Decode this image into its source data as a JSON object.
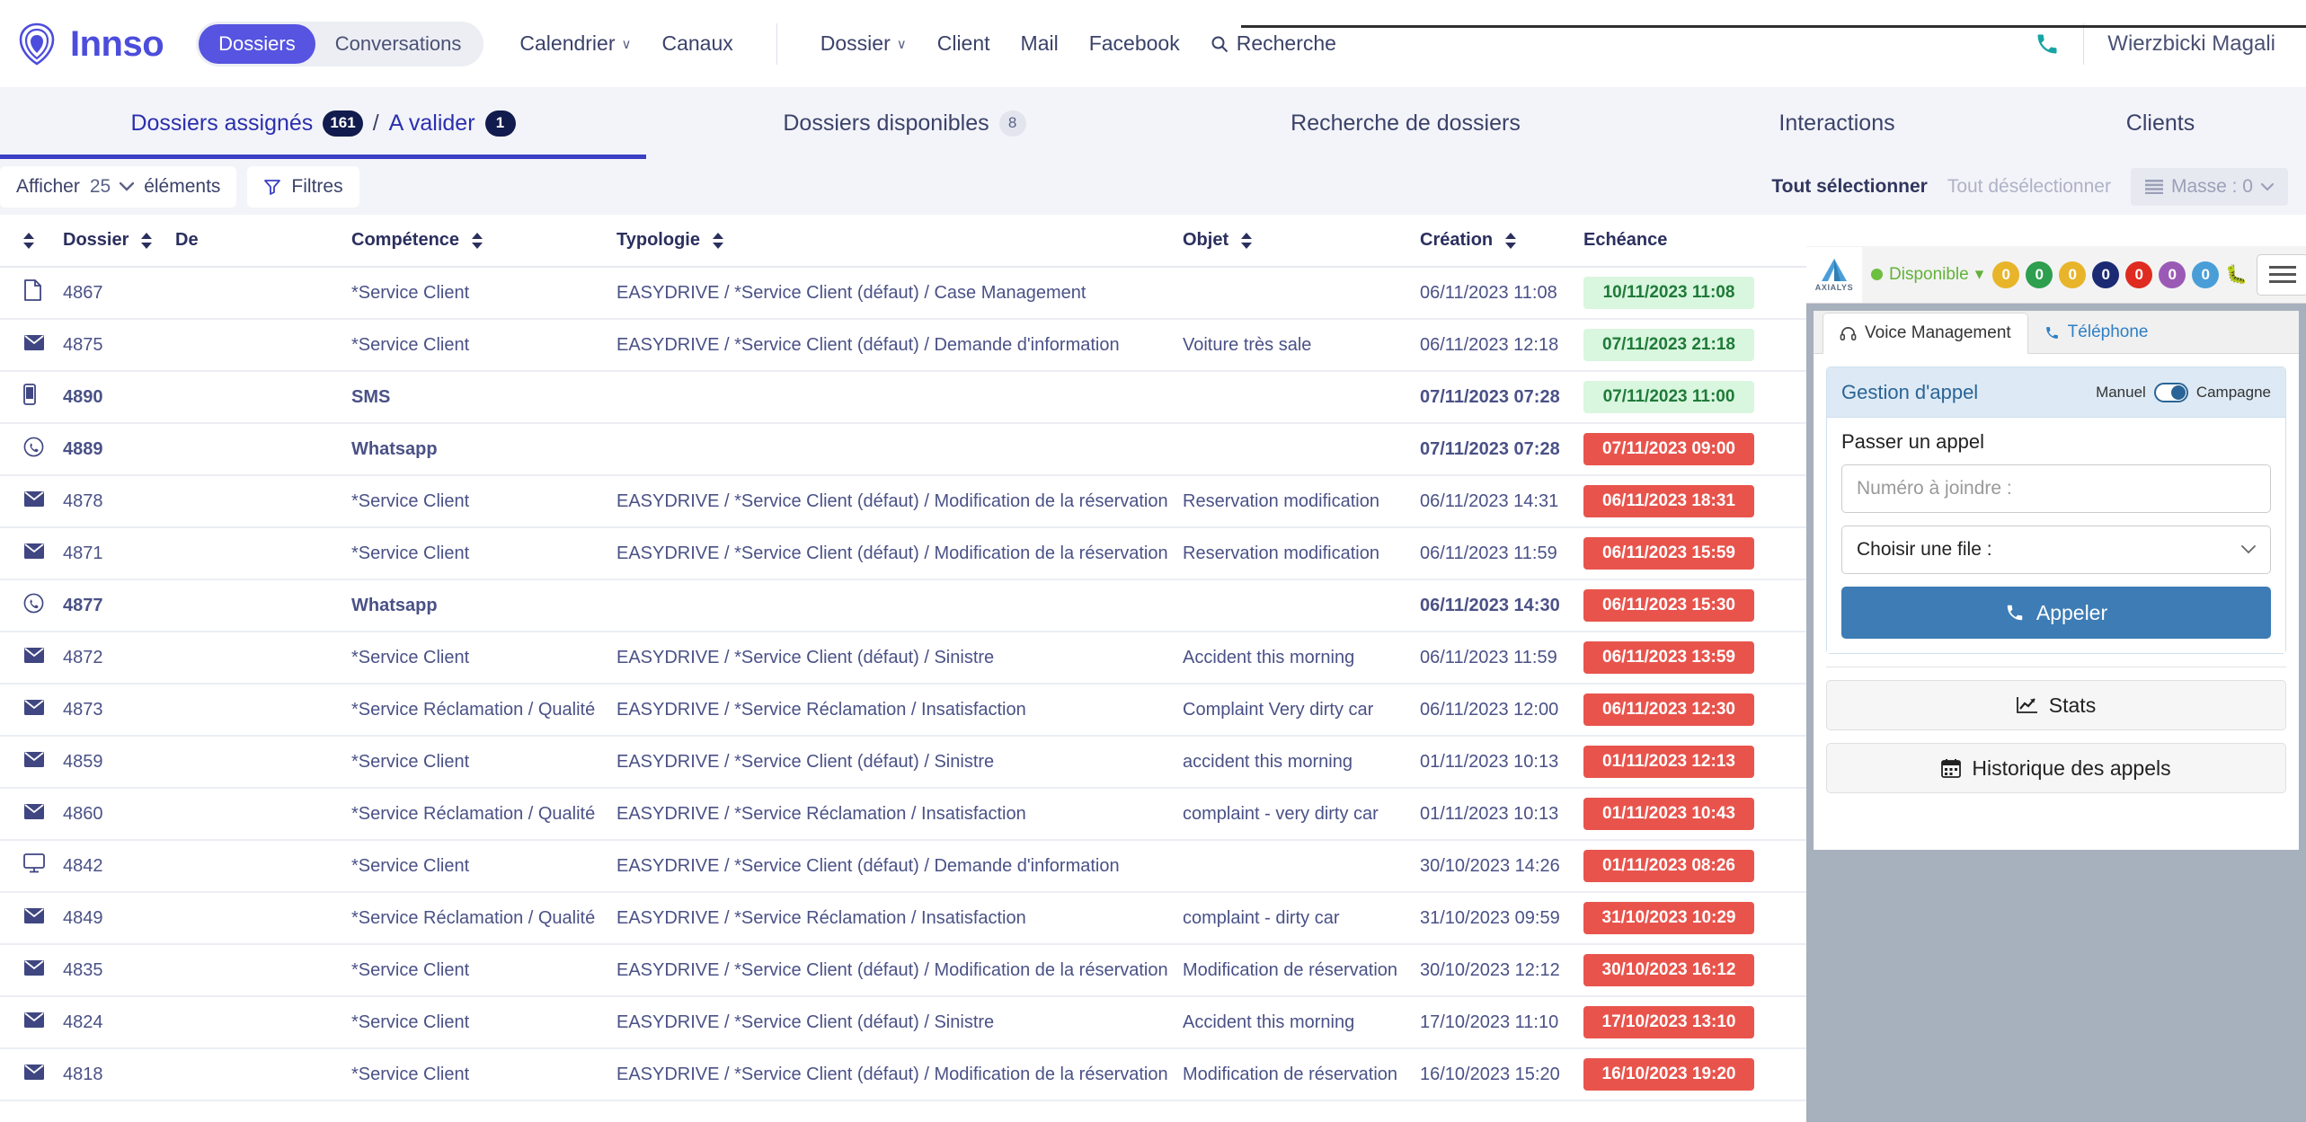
{
  "brand": {
    "name": "Innso",
    "logo_icon": "innso-logo-icon"
  },
  "topnav": {
    "segments": [
      {
        "label": "Dossiers",
        "active": true
      },
      {
        "label": "Conversations",
        "active": false
      }
    ],
    "items": [
      {
        "label": "Calendrier",
        "caret": "∨"
      },
      {
        "label": "Canaux",
        "caret": ""
      }
    ],
    "items2": [
      {
        "label": "Dossier",
        "caret": "∨"
      },
      {
        "label": "Client",
        "caret": ""
      },
      {
        "label": "Mail",
        "caret": ""
      },
      {
        "label": "Facebook",
        "caret": ""
      }
    ],
    "search_label": "Recherche",
    "search_icon": "search-icon",
    "phone_icon": "phone-icon",
    "username": "Wierzbicki Magali"
  },
  "maintabs": [
    {
      "label": "Dossiers assignés",
      "badge": "161",
      "label2": "A valider",
      "badge2": "1",
      "separator": "/",
      "active": true
    },
    {
      "label": "Dossiers disponibles",
      "badge": "8",
      "active": false
    },
    {
      "label": "Recherche de dossiers",
      "active": false
    },
    {
      "label": "Interactions",
      "active": false
    },
    {
      "label": "Clients",
      "active": false
    }
  ],
  "toolbar": {
    "show_label": "Afficher",
    "show_value": "25",
    "elements_label": "éléments",
    "filters_label": "Filtres",
    "filter_icon": "filter-icon",
    "select_all": "Tout sélectionner",
    "deselect_all": "Tout désélectionner",
    "mass_label": "Masse : 0",
    "mass_icon": "list-icon"
  },
  "table": {
    "columns": [
      {
        "key": "icon",
        "label": "",
        "sortable": true
      },
      {
        "key": "dossier",
        "label": "Dossier",
        "sortable": true
      },
      {
        "key": "de",
        "label": "De",
        "sortable": true
      },
      {
        "key": "competence",
        "label": "Compétence",
        "sortable": true
      },
      {
        "key": "typologie",
        "label": "Typologie",
        "sortable": true
      },
      {
        "key": "objet",
        "label": "Objet",
        "sortable": true
      },
      {
        "key": "creation",
        "label": "Création",
        "sortable": true
      },
      {
        "key": "echeance",
        "label": "Echéance",
        "sortable": false
      }
    ],
    "rows": [
      {
        "icon": "document-icon",
        "glyph": "🗋",
        "dossier": "4867",
        "de": "",
        "competence": "*Service Client",
        "typologie": "EASYDRIVE / *Service Client (défaut) / Case Management",
        "objet": "",
        "creation": "06/11/2023 11:08",
        "echeance": "10/11/2023 11:08",
        "echeance_state": "green",
        "bold": false
      },
      {
        "icon": "mail-icon",
        "glyph": "✉",
        "dossier": "4875",
        "de": "",
        "competence": "*Service Client",
        "typologie": "EASYDRIVE / *Service Client (défaut) / Demande d'information",
        "objet": "Voiture très sale",
        "creation": "06/11/2023 12:18",
        "echeance": "07/11/2023 21:18",
        "echeance_state": "green",
        "bold": false
      },
      {
        "icon": "sms-icon",
        "glyph": "📱",
        "dossier": "4890",
        "de": "",
        "competence": "SMS",
        "typologie": "",
        "objet": "",
        "creation": "07/11/2023 07:28",
        "echeance": "07/11/2023 11:00",
        "echeance_state": "green",
        "bold": true
      },
      {
        "icon": "whatsapp-icon",
        "glyph": "ⓦ",
        "dossier": "4889",
        "de": "",
        "competence": "Whatsapp",
        "typologie": "",
        "objet": "",
        "creation": "07/11/2023 07:28",
        "echeance": "07/11/2023 09:00",
        "echeance_state": "red",
        "bold": true
      },
      {
        "icon": "mail-icon",
        "glyph": "✉",
        "dossier": "4878",
        "de": "",
        "competence": "*Service Client",
        "typologie": "EASYDRIVE / *Service Client (défaut) / Modification de la réservation",
        "objet": "Reservation modification",
        "creation": "06/11/2023 14:31",
        "echeance": "06/11/2023 18:31",
        "echeance_state": "red",
        "bold": false
      },
      {
        "icon": "mail-icon",
        "glyph": "✉",
        "dossier": "4871",
        "de": "",
        "competence": "*Service Client",
        "typologie": "EASYDRIVE / *Service Client (défaut) / Modification de la réservation",
        "objet": "Reservation modification",
        "creation": "06/11/2023 11:59",
        "echeance": "06/11/2023 15:59",
        "echeance_state": "red",
        "bold": false
      },
      {
        "icon": "whatsapp-icon",
        "glyph": "ⓦ",
        "dossier": "4877",
        "de": "",
        "competence": "Whatsapp",
        "typologie": "",
        "objet": "",
        "creation": "06/11/2023 14:30",
        "echeance": "06/11/2023 15:30",
        "echeance_state": "red",
        "bold": true
      },
      {
        "icon": "mail-icon",
        "glyph": "✉",
        "dossier": "4872",
        "de": "",
        "competence": "*Service Client",
        "typologie": "EASYDRIVE / *Service Client (défaut) / Sinistre",
        "objet": "Accident this morning",
        "creation": "06/11/2023 11:59",
        "echeance": "06/11/2023 13:59",
        "echeance_state": "red",
        "bold": false
      },
      {
        "icon": "mail-icon",
        "glyph": "✉",
        "dossier": "4873",
        "de": "",
        "competence": "*Service Réclamation / Qualité",
        "typologie": "EASYDRIVE / *Service Réclamation / Insatisfaction",
        "objet": "Complaint Very dirty car",
        "creation": "06/11/2023 12:00",
        "echeance": "06/11/2023 12:30",
        "echeance_state": "red",
        "bold": false
      },
      {
        "icon": "mail-icon",
        "glyph": "✉",
        "dossier": "4859",
        "de": "",
        "competence": "*Service Client",
        "typologie": "EASYDRIVE / *Service Client (défaut) / Sinistre",
        "objet": "accident this morning",
        "creation": "01/11/2023 10:13",
        "echeance": "01/11/2023 12:13",
        "echeance_state": "red",
        "bold": false
      },
      {
        "icon": "mail-icon",
        "glyph": "✉",
        "dossier": "4860",
        "de": "",
        "competence": "*Service Réclamation / Qualité",
        "typologie": "EASYDRIVE / *Service Réclamation / Insatisfaction",
        "objet": "complaint - very dirty car",
        "creation": "01/11/2023 10:13",
        "echeance": "01/11/2023 10:43",
        "echeance_state": "red",
        "bold": false
      },
      {
        "icon": "web-icon",
        "glyph": "🖥",
        "dossier": "4842",
        "de": "",
        "competence": "*Service Client",
        "typologie": "EASYDRIVE / *Service Client (défaut) / Demande d'information",
        "objet": "",
        "creation": "30/10/2023 14:26",
        "echeance": "01/11/2023 08:26",
        "echeance_state": "red",
        "bold": false
      },
      {
        "icon": "mail-icon",
        "glyph": "✉",
        "dossier": "4849",
        "de": "",
        "competence": "*Service Réclamation / Qualité",
        "typologie": "EASYDRIVE / *Service Réclamation / Insatisfaction",
        "objet": "complaint - dirty car",
        "creation": "31/10/2023 09:59",
        "echeance": "31/10/2023 10:29",
        "echeance_state": "red",
        "bold": false
      },
      {
        "icon": "mail-icon",
        "glyph": "✉",
        "dossier": "4835",
        "de": "",
        "competence": "*Service Client",
        "typologie": "EASYDRIVE / *Service Client (défaut) / Modification de la réservation",
        "objet": "Modification de réservation",
        "creation": "30/10/2023 12:12",
        "echeance": "30/10/2023 16:12",
        "echeance_state": "red",
        "bold": false
      },
      {
        "icon": "mail-icon",
        "glyph": "✉",
        "dossier": "4824",
        "de": "",
        "competence": "*Service Client",
        "typologie": "EASYDRIVE / *Service Client (défaut) / Sinistre",
        "objet": "Accident this morning",
        "creation": "17/10/2023 11:10",
        "echeance": "17/10/2023 13:10",
        "echeance_state": "red",
        "bold": false
      },
      {
        "icon": "mail-icon",
        "glyph": "✉",
        "dossier": "4818",
        "de": "",
        "competence": "*Service Client",
        "typologie": "EASYDRIVE / *Service Client (défaut) / Modification de la réservation",
        "objet": "Modification de réservation",
        "creation": "16/10/2023 15:20",
        "echeance": "16/10/2023 19:20",
        "echeance_state": "red",
        "bold": false
      }
    ]
  },
  "phonepanel": {
    "vendor": "AXIALYS",
    "status": "Disponible",
    "status_caret": "▾",
    "counters": [
      {
        "value": "0",
        "color": "#e8b42a"
      },
      {
        "value": "0",
        "color": "#2e9e4f"
      },
      {
        "value": "0",
        "color": "#e8b42a"
      },
      {
        "value": "0",
        "color": "#1b2a73"
      },
      {
        "value": "0",
        "color": "#e02b20"
      },
      {
        "value": "0",
        "color": "#9b59b6"
      },
      {
        "value": "0",
        "color": "#4a9ed8"
      }
    ],
    "bug_icon": "bug-icon",
    "menu_icon": "hamburger-icon",
    "tabs": [
      {
        "label": "Voice Management",
        "icon": "headset-icon",
        "active": true
      },
      {
        "label": "Téléphone",
        "icon": "phone-icon",
        "active": false
      }
    ],
    "call_card": {
      "title": "Gestion d'appel",
      "toggle_left": "Manuel",
      "toggle_right": "Campagne",
      "section_label": "Passer un appel",
      "number_placeholder": "Numéro à joindre :",
      "queue_value": "Choisir une file :",
      "queue_caret": "∨",
      "call_button": "Appeler",
      "call_icon": "phone-icon"
    },
    "stats_button": "Stats",
    "stats_icon": "chart-icon",
    "history_button": "Historique des appels",
    "history_icon": "calendar-icon"
  },
  "colors": {
    "brand_purple": "#5654e0",
    "tab_active": "#3a3fc4",
    "due_green_bg": "#d9f6df",
    "due_green_fg": "#1f7a38",
    "due_red_bg": "#e8544c",
    "panel_blue": "#3d7cb5"
  }
}
